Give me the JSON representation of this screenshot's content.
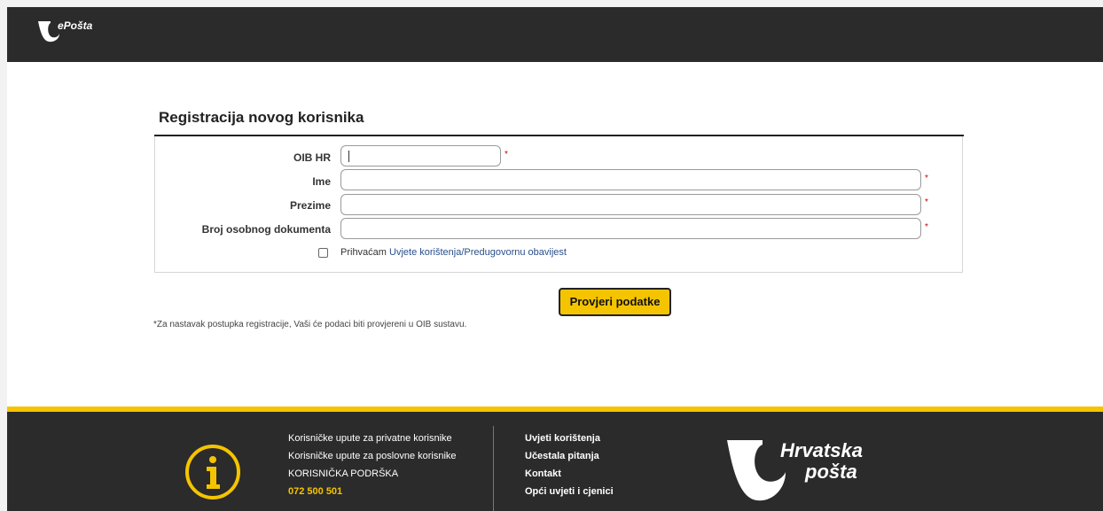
{
  "header": {
    "logo_text": "ePošta"
  },
  "form": {
    "title": "Registracija novog korisnika",
    "fields": [
      {
        "label": "OIB HR",
        "value": "",
        "required_mark": "*"
      },
      {
        "label": "Ime",
        "value": "",
        "required_mark": "*"
      },
      {
        "label": "Prezime",
        "value": "",
        "required_mark": "*"
      },
      {
        "label": "Broj osobnog dokumenta",
        "value": "",
        "required_mark": "*"
      }
    ],
    "accept": {
      "checked": false,
      "text": "Prihvaćam",
      "link_text": "Uvjete korištenja/Predugovornu obavijest"
    },
    "submit_label": "Provjeri podatke",
    "note": "*Za nastavak postupka registracije, Vaši će podaci biti provjereni u OIB sustavu."
  },
  "footer": {
    "accent_color": "#f5c400",
    "col1": [
      "Korisničke upute za privatne korisnike",
      "Korisničke upute za poslovne korisnike",
      "KORISNIČKA PODRŠKA"
    ],
    "phone": "072 500 501",
    "col2": [
      "Uvjeti korištenja",
      "Učestala pitanja",
      "Kontakt",
      "Opći uvjeti i cjenici"
    ],
    "brand_line1": "Hrvatska",
    "brand_line2": "pošta"
  }
}
